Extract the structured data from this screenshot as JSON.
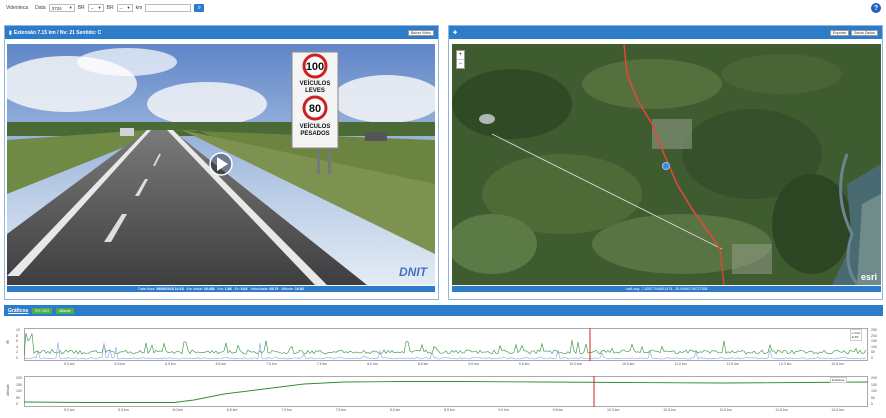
{
  "toolbar": {
    "label": "Videoteca",
    "date_label": "Data",
    "date_value": "3734",
    "br_label": "BR",
    "br_value": "--",
    "km_label": "km",
    "search_icon": "search-icon"
  },
  "help": {
    "icon": "question-icon",
    "label": "?"
  },
  "video_panel": {
    "header": "Extensão 7.15 km / Nv: 21 Sentido: C",
    "corner_button": "Baixar Vídeo",
    "sign": {
      "top": "100",
      "top_label1": "VEÍCULOS",
      "top_label2": "LEVES",
      "bottom": "80",
      "bottom_label1": "VEÍCULOS",
      "bottom_label2": "PESADOS"
    },
    "watermark": "DNIT",
    "info": [
      {
        "label": "Data Hora:",
        "value": "26/06/2018 14:15"
      },
      {
        "label": "Km Inicial:",
        "value": "16.488"
      },
      {
        "label": "Km:",
        "value": "1.86"
      },
      {
        "label": "Ex:",
        "value": "5.64"
      },
      {
        "label": "Velocidade:",
        "value": "65.79"
      },
      {
        "label": "Altitude:",
        "value": "16.88"
      }
    ]
  },
  "map_panel": {
    "header_icon": "gear-icon",
    "buttons": [
      "Exportar",
      "Salvar Dados"
    ],
    "coords": "Lat/Long: -7.82677046511575, -35.09661705727538",
    "esri": "esri",
    "zoom_in": "+",
    "zoom_out": "−"
  },
  "charts_bar": {
    "title": "Gráficos",
    "btn1": "IRI / IGG",
    "btn2": "Altitude"
  },
  "chart_top": {
    "ylabel": "IRI",
    "legend": [
      "IGG",
      "IRI"
    ],
    "yticks": [
      "10",
      "8",
      "6",
      "4",
      "2",
      "0"
    ],
    "xticks": [
      "5.0 km",
      "5.5 km",
      "6.0 km",
      "6.5 km",
      "7.0 km",
      "7.5 km",
      "8.0 km",
      "8.5 km",
      "9.0 km",
      "9.5 km",
      "10.0 km",
      "10.5 km",
      "11.0 km",
      "11.5 km",
      "12.0 km",
      "12.5 km"
    ],
    "right_ticks": [
      "250",
      "200",
      "150",
      "100",
      "50",
      "0"
    ]
  },
  "chart_bottom": {
    "ylabel": "Altitude",
    "legend": "Altitude",
    "yticks": [
      "200",
      "150",
      "100",
      "50",
      "0"
    ],
    "xticks": [
      "5.0 km",
      "5.5 km",
      "6.0 km",
      "6.5 km",
      "7.0 km",
      "7.5 km",
      "8.0 km",
      "8.5 km",
      "9.0 km",
      "9.5 km",
      "10.0 km",
      "10.5 km",
      "11.0 km",
      "11.5 km",
      "12.0 km"
    ],
    "right_ticks": [
      "200",
      "150",
      "100",
      "50",
      "0"
    ]
  },
  "colors": {
    "primary": "#2d7cc9",
    "series_green": "#2f8f3a",
    "series_blue": "#8fa3e6",
    "cursor": "#d42020"
  }
}
